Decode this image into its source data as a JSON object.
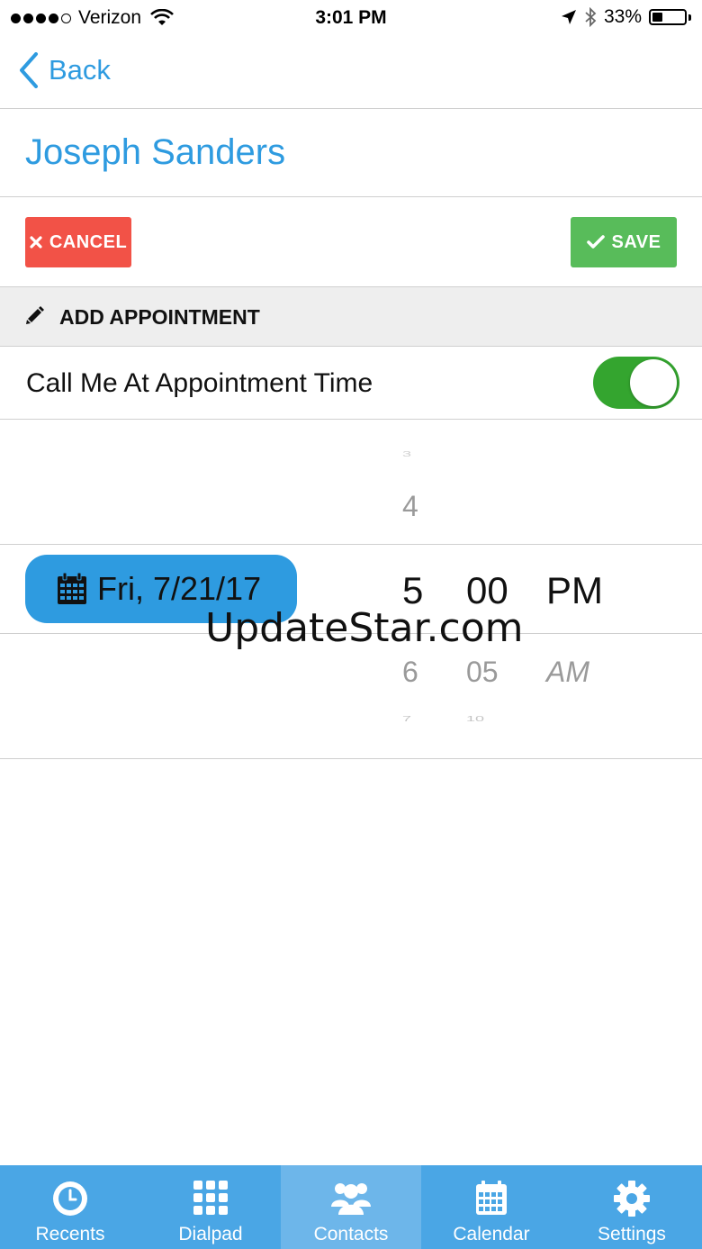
{
  "status_bar": {
    "carrier": "Verizon",
    "time": "3:01 PM",
    "battery": "33%",
    "battery_level": 0.33,
    "icons": [
      "signal-dots",
      "wifi-icon",
      "location-arrow-icon",
      "bluetooth-icon",
      "battery-icon"
    ]
  },
  "nav": {
    "back_label": "Back"
  },
  "contact": {
    "name": "Joseph Sanders"
  },
  "actions": {
    "cancel_label": "CANCEL",
    "save_label": "SAVE"
  },
  "section": {
    "title": "ADD APPOINTMENT"
  },
  "call_me": {
    "label": "Call Me At Appointment Time",
    "enabled": true
  },
  "picker": {
    "date_label": "Fri, 7/21/17",
    "hours": [
      "3",
      "4",
      "5",
      "6",
      "7"
    ],
    "minutes": [
      "00",
      "05",
      "10"
    ],
    "periods": [
      "PM",
      "AM"
    ],
    "selected_hour": "5",
    "selected_minute": "00",
    "selected_period": "PM"
  },
  "watermark": "UpdateStar.com",
  "tabbar": {
    "tabs": [
      {
        "label": "Recents",
        "icon": "clock-icon",
        "active": false
      },
      {
        "label": "Dialpad",
        "icon": "dialpad-icon",
        "active": false
      },
      {
        "label": "Contacts",
        "icon": "contacts-icon",
        "active": true
      },
      {
        "label": "Calendar",
        "icon": "calendar-icon",
        "active": false
      },
      {
        "label": "Settings",
        "icon": "gear-icon",
        "active": false
      }
    ]
  },
  "colors": {
    "accent": "#2e9be0",
    "cancel": "#f25247",
    "save": "#58bc5a",
    "toggle_on": "#34a52f",
    "tabbar": "#4aa6e5"
  }
}
